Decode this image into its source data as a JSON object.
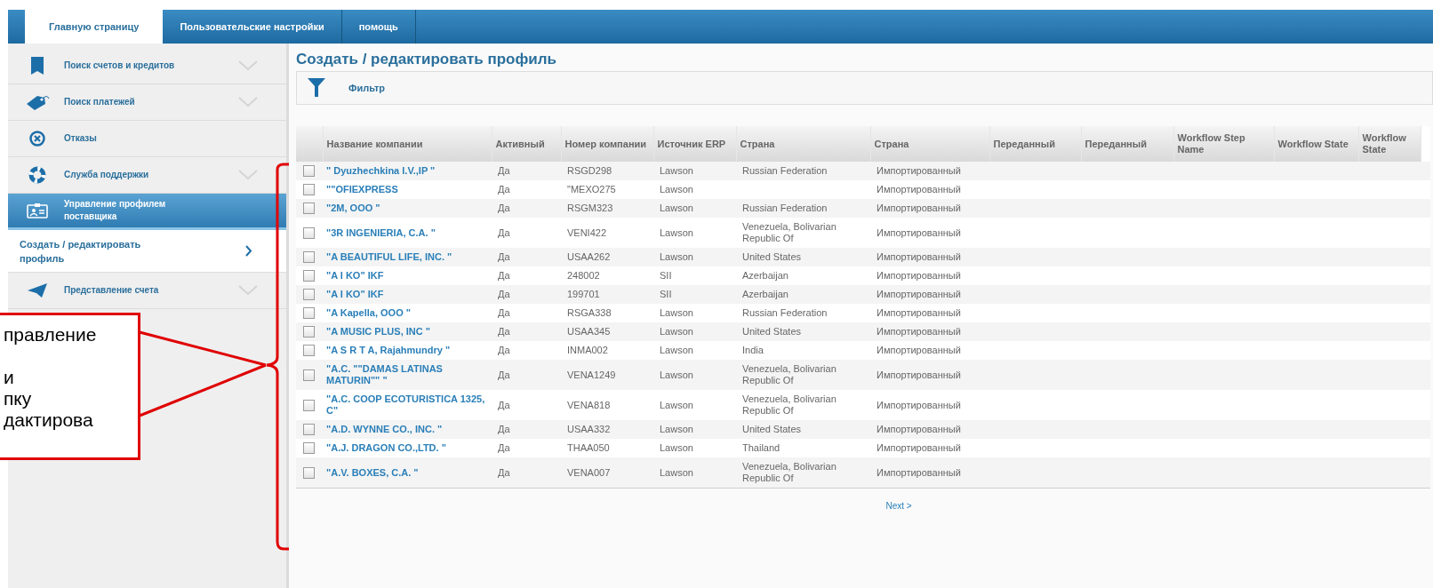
{
  "nav_tabs": [
    {
      "label": "Главную страницу",
      "selected": true
    },
    {
      "label": "Пользовательские настройки",
      "selected": false
    },
    {
      "label": "помощь",
      "selected": false
    }
  ],
  "sidebar": {
    "items": [
      {
        "label": "Поиск счетов и кредитов",
        "kind": "menu",
        "selected": false
      },
      {
        "label": "Поиск платежей",
        "kind": "menu",
        "selected": false
      },
      {
        "label": "Отказы",
        "kind": "plain",
        "selected": false
      },
      {
        "label": "Служба поддержки",
        "kind": "menu",
        "selected": false
      },
      {
        "label": "Управление профилем поставщика",
        "kind": "plain",
        "selected": true
      },
      {
        "label": "Создать / редактировать профиль",
        "kind": "submenu",
        "selected": false
      },
      {
        "label": "Представление счета",
        "kind": "menu",
        "selected": false
      }
    ]
  },
  "page_title": "Создать / редактировать профиль",
  "filter_button": "Фильтр",
  "table": {
    "columns": [
      "Название компании",
      "Активный",
      "Номер компании",
      "Источник ERP",
      "Страна",
      "Страна",
      "Переданный",
      "Переданный",
      "Workflow Step Name",
      "Workflow State",
      "Workflow State"
    ],
    "rows": [
      {
        "checked": false,
        "cells": [
          "\" Dyuzhechkina I.V.,IP \"",
          "Да",
          "RSGD298",
          "Lawson",
          "Russian Federation",
          "Импортированный"
        ]
      },
      {
        "checked": false,
        "cells": [
          "\"\"OFIEXPRESS",
          "Да",
          "\"MEXO275",
          "Lawson",
          "",
          "Импортированный"
        ]
      },
      {
        "checked": false,
        "cells": [
          "\"2M, OOO \"",
          "Да",
          "RSGM323",
          "Lawson",
          "Russian Federation",
          "Импортированный"
        ]
      },
      {
        "checked": false,
        "cells": [
          "\"3R INGENIERIA, C.A. \"",
          "Да",
          "VENI422",
          "Lawson",
          "Venezuela, Bolivarian Republic Of",
          "Импортированный"
        ]
      },
      {
        "checked": false,
        "cells": [
          "\"A BEAUTIFUL LIFE, INC. \"",
          "Да",
          "USAA262",
          "Lawson",
          "United States",
          "Импортированный"
        ]
      },
      {
        "checked": false,
        "cells": [
          "\"A I KO\" IKF",
          "Да",
          "248002",
          "SII",
          "Azerbaijan",
          "Импортированный"
        ]
      },
      {
        "checked": false,
        "cells": [
          "\"A I KO\" IKF",
          "Да",
          "199701",
          "SII",
          "Azerbaijan",
          "Импортированный"
        ]
      },
      {
        "checked": false,
        "cells": [
          "\"A Kapella, OOO \"",
          "Да",
          "RSGA338",
          "Lawson",
          "Russian Federation",
          "Импортированный"
        ]
      },
      {
        "checked": false,
        "cells": [
          "\"A MUSIC PLUS, INC \"",
          "Да",
          "USAA345",
          "Lawson",
          "United States",
          "Импортированный"
        ]
      },
      {
        "checked": false,
        "cells": [
          "\"A S R T A, Rajahmundry \"",
          "Да",
          "INMA002",
          "Lawson",
          "India",
          "Импортированный"
        ]
      },
      {
        "checked": false,
        "cells": [
          "\"A.C. \"\"DAMAS LATINAS MATURIN\"\" \"",
          "Да",
          "VENA1249",
          "Lawson",
          "Venezuela, Bolivarian Republic Of",
          "Импортированный"
        ]
      },
      {
        "checked": false,
        "cells": [
          "\"A.C. COOP ECOTURISTICA 1325, C\"",
          "Да",
          "VENA818",
          "Lawson",
          "Venezuela, Bolivarian Republic Of",
          "Импортированный"
        ]
      },
      {
        "checked": false,
        "cells": [
          "\"A.D. WYNNE CO., INC. \"",
          "Да",
          "USAA332",
          "Lawson",
          "United States",
          "Импортированный"
        ]
      },
      {
        "checked": false,
        "cells": [
          "\"A.J. DRAGON CO.,LTD. \"",
          "Да",
          "THAA050",
          "Lawson",
          "Thailand",
          "Импортированный"
        ]
      },
      {
        "checked": false,
        "cells": [
          "\"A.V. BOXES, C.A. \"",
          "Да",
          "VENA007",
          "Lawson",
          "Venezuela, Bolivarian Republic Of",
          "Импортированный"
        ]
      }
    ]
  },
  "next_link": "Next >",
  "callout": {
    "lines": [
      "правление",
      "и",
      "пку",
      "дактирова"
    ]
  }
}
